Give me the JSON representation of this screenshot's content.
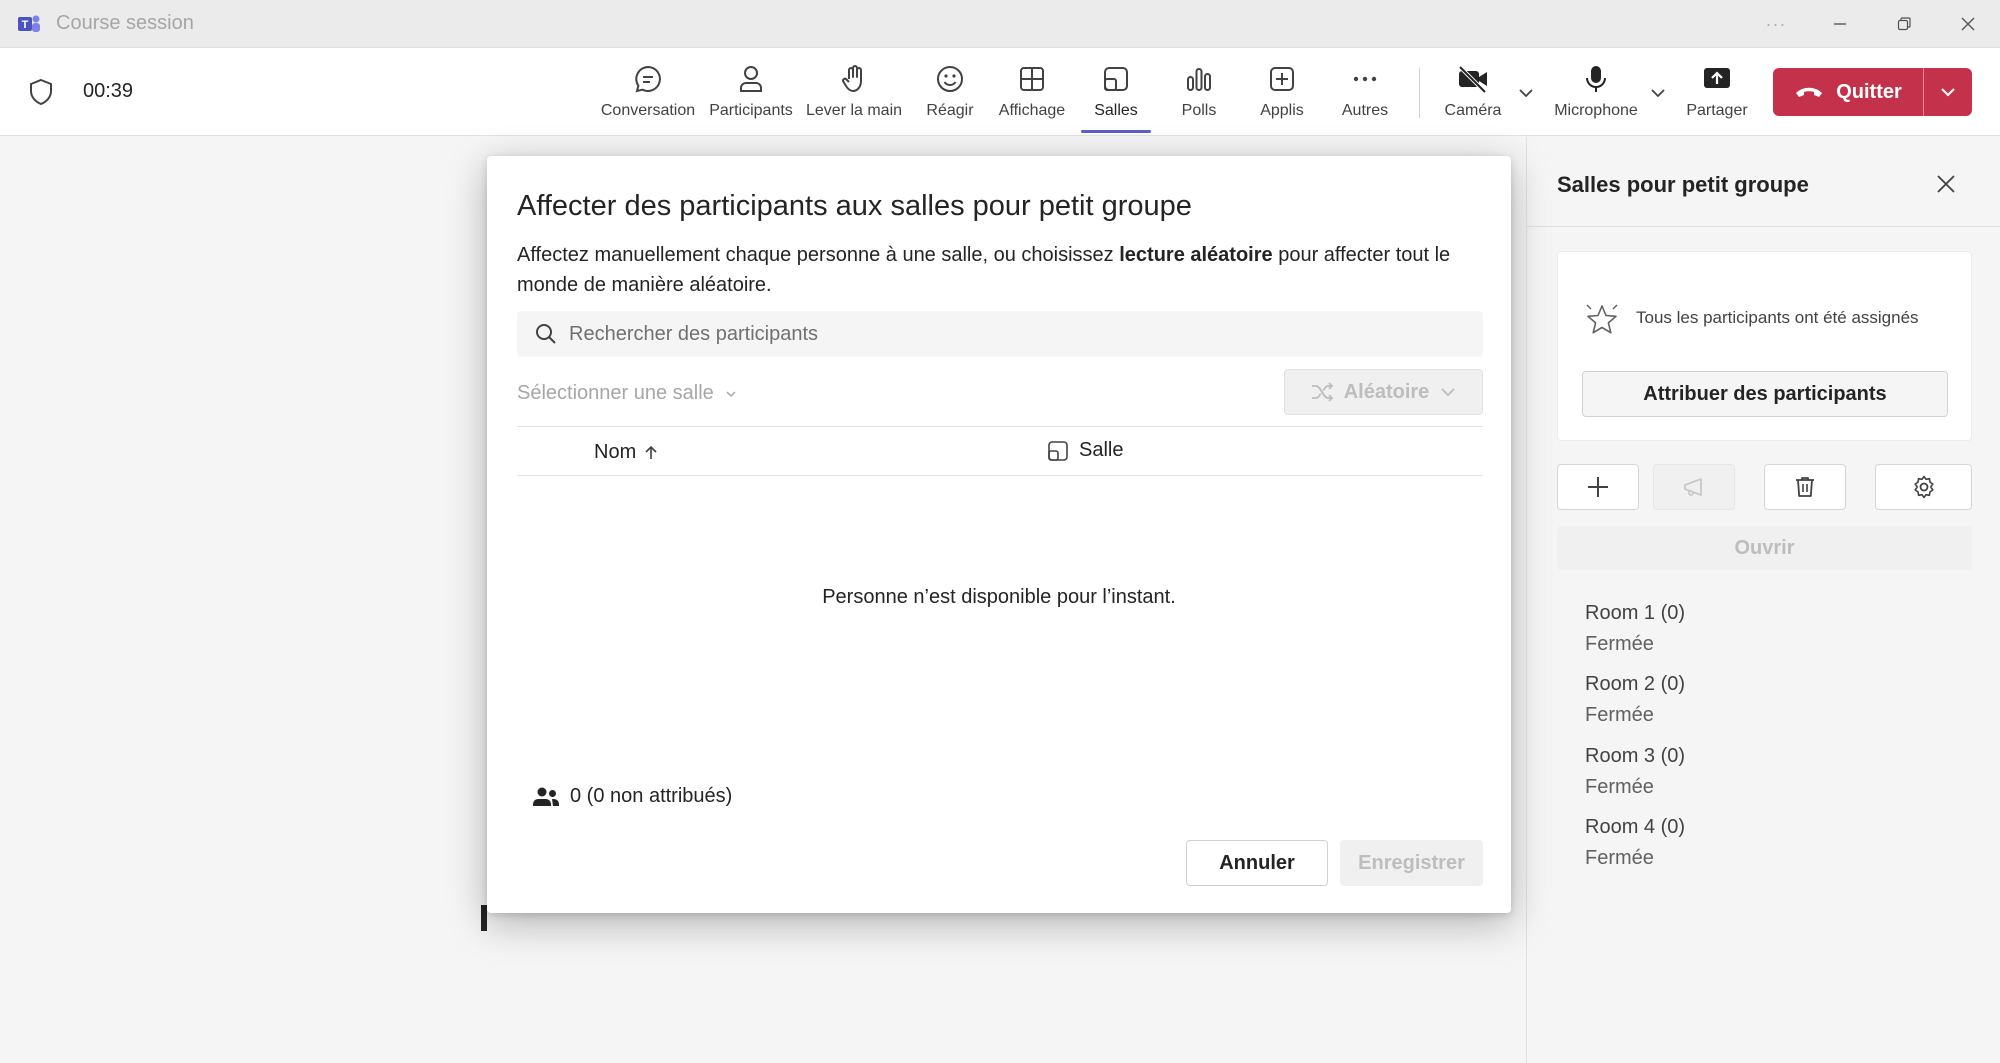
{
  "window": {
    "title": "Course session",
    "more_glyph": "···"
  },
  "toolbar": {
    "timer": "00:39",
    "buttons": {
      "conversation": "Conversation",
      "participants": "Participants",
      "raise_hand": "Lever la main",
      "react": "Réagir",
      "view": "Affichage",
      "rooms": "Salles",
      "polls": "Polls",
      "apps": "Applis",
      "more": "Autres",
      "camera": "Caméra",
      "microphone": "Microphone",
      "share": "Partager"
    },
    "active_tab": "Salles",
    "quit_label": "Quitter",
    "quit_color": "#c4314b",
    "accent_color": "#5b5fc7"
  },
  "modal": {
    "title": "Affecter des participants aux salles pour petit groupe",
    "desc_before": "Affectez manuellement chaque personne à une salle, ou choisissez ",
    "desc_bold": "lecture aléatoire",
    "desc_after": " pour affecter tout le monde de manière aléatoire.",
    "search_placeholder": "Rechercher des participants",
    "select_room": "Sélectionner une salle",
    "random_label": "Aléatoire",
    "col_name": "Nom",
    "col_room": "Salle",
    "empty_message": "Personne n’est disponible pour l’instant.",
    "count_label": "0 (0 non attribués)",
    "cancel_label": "Annuler",
    "save_label": "Enregistrer"
  },
  "panel": {
    "title": "Salles pour petit groupe",
    "assigned_message": "Tous les participants ont été assignés",
    "assign_button": "Attribuer des participants",
    "open_button": "Ouvrir",
    "rooms": [
      {
        "name": "Room 1  (0)",
        "status": "Fermée"
      },
      {
        "name": "Room 2  (0)",
        "status": "Fermée"
      },
      {
        "name": "Room 3  (0)",
        "status": "Fermée"
      },
      {
        "name": "Room 4  (0)",
        "status": "Fermée"
      }
    ]
  }
}
